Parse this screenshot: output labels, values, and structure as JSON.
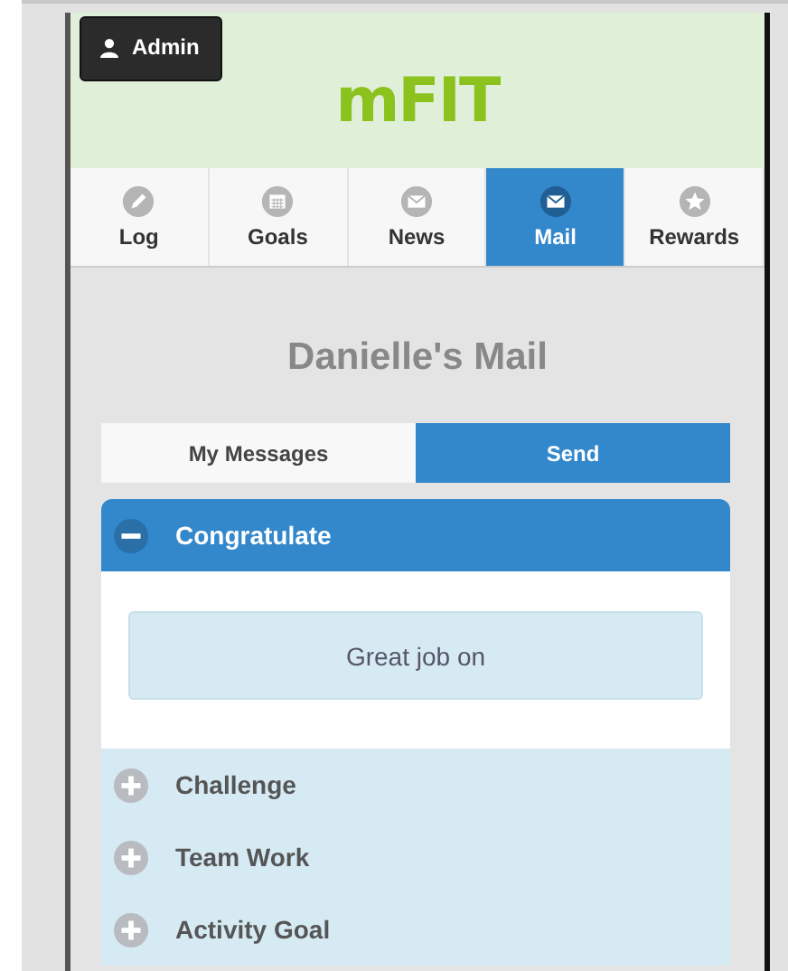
{
  "header": {
    "admin_button": "Admin",
    "logo": "mFIT"
  },
  "nav_tabs": [
    {
      "label": "Log",
      "selected": false
    },
    {
      "label": "Goals",
      "selected": false
    },
    {
      "label": "News",
      "selected": false
    },
    {
      "label": "Mail",
      "selected": true
    },
    {
      "label": "Rewards",
      "selected": false
    }
  ],
  "page_title": "Danielle's Mail",
  "mail_tabs": [
    {
      "label": "My Messages",
      "selected": false
    },
    {
      "label": "Send",
      "selected": true
    }
  ],
  "sections": [
    {
      "title": "Congratulate",
      "expanded": true,
      "message": "Great job on"
    },
    {
      "title": "Challenge",
      "expanded": false
    },
    {
      "title": "Team Work",
      "expanded": false
    },
    {
      "title": "Activity Goal",
      "expanded": false
    }
  ]
}
